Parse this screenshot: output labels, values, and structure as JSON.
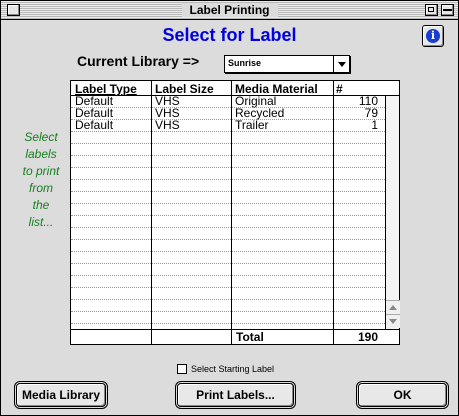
{
  "window": {
    "title": "Label Printing"
  },
  "heading": "Select for Label",
  "library": {
    "label": "Current Library =>",
    "selected": "Sunrise"
  },
  "side_note": [
    "Select",
    "labels",
    "to print",
    "from",
    "the",
    "list..."
  ],
  "table": {
    "columns": [
      "Label Type",
      "Label Size",
      "Media Material",
      "#"
    ],
    "rows": [
      [
        "Default",
        "VHS",
        "Original",
        "110"
      ],
      [
        "Default",
        "VHS",
        "Recycled",
        "79"
      ],
      [
        "Default",
        "VHS",
        "Trailer",
        "1"
      ]
    ],
    "total_label": "Total",
    "total_value": "190"
  },
  "starting_label": "Select Starting Label",
  "buttons": {
    "media_library": "Media Library",
    "print_labels": "Print Labels...",
    "ok": "OK"
  },
  "colors": {
    "heading": "#0000e0",
    "side_note": "#14801e",
    "info": "#1a3fd0"
  },
  "icons": {
    "info": "info-icon",
    "close": "close-box",
    "zoom": "zoom-box",
    "collapse": "collapse-box"
  }
}
